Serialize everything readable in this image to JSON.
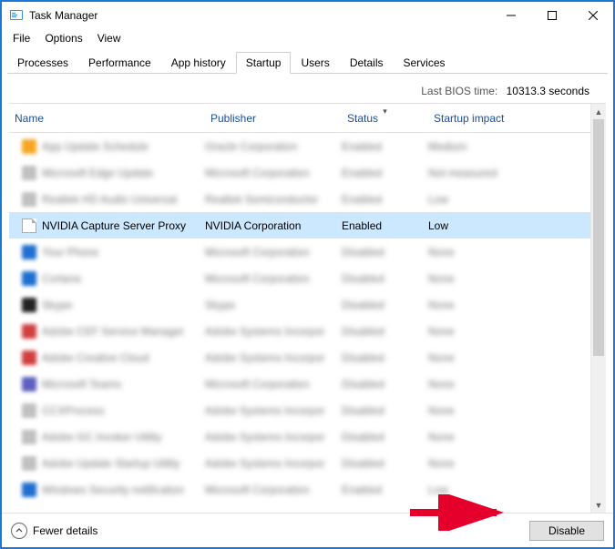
{
  "window": {
    "title": "Task Manager"
  },
  "menu": {
    "file": "File",
    "options": "Options",
    "view": "View"
  },
  "tabs": {
    "processes": "Processes",
    "performance": "Performance",
    "app_history": "App history",
    "startup": "Startup",
    "users": "Users",
    "details": "Details",
    "services": "Services"
  },
  "bios": {
    "label": "Last BIOS time:",
    "value": "10313.3 seconds"
  },
  "columns": {
    "name": "Name",
    "publisher": "Publisher",
    "status": "Status",
    "impact": "Startup impact"
  },
  "selected_row": {
    "name": "NVIDIA Capture Server Proxy",
    "publisher": "NVIDIA Corporation",
    "status": "Enabled",
    "impact": "Low"
  },
  "blurred_rows": [
    {
      "icon_color": "#f5a623",
      "name": "App Update Schedule",
      "publisher": "Oracle Corporation",
      "status": "Enabled",
      "impact": "Medium"
    },
    {
      "icon_color": "#c0c0c0",
      "name": "Microsoft Edge Update",
      "publisher": "Microsoft Corporation",
      "status": "Enabled",
      "impact": "Not measured"
    },
    {
      "icon_color": "#c0c0c0",
      "name": "Realtek HD Audio Universal",
      "publisher": "Realtek Semiconductor",
      "status": "Enabled",
      "impact": "Low"
    }
  ],
  "blurred_rows_after": [
    {
      "icon_color": "#1f6fd0",
      "name": "Your Phone",
      "publisher": "Microsoft Corporation",
      "status": "Disabled",
      "impact": "None"
    },
    {
      "icon_color": "#1f6fd0",
      "name": "Cortana",
      "publisher": "Microsoft Corporation",
      "status": "Disabled",
      "impact": "None"
    },
    {
      "icon_color": "#222222",
      "name": "Skype",
      "publisher": "Skype",
      "status": "Disabled",
      "impact": "None"
    },
    {
      "icon_color": "#d04040",
      "name": "Adobe CEF Service Manager",
      "publisher": "Adobe Systems Incorpor",
      "status": "Disabled",
      "impact": "None"
    },
    {
      "icon_color": "#d04040",
      "name": "Adobe Creative Cloud",
      "publisher": "Adobe Systems Incorpor",
      "status": "Disabled",
      "impact": "None"
    },
    {
      "icon_color": "#6060c0",
      "name": "Microsoft Teams",
      "publisher": "Microsoft Corporation",
      "status": "Disabled",
      "impact": "None"
    },
    {
      "icon_color": "#c0c0c0",
      "name": "CCXProcess",
      "publisher": "Adobe Systems Incorpor",
      "status": "Disabled",
      "impact": "None"
    },
    {
      "icon_color": "#c0c0c0",
      "name": "Adobe GC Invoker Utility",
      "publisher": "Adobe Systems Incorpor",
      "status": "Disabled",
      "impact": "None"
    },
    {
      "icon_color": "#c0c0c0",
      "name": "Adobe Update Startup Utility",
      "publisher": "Adobe Systems Incorpor",
      "status": "Disabled",
      "impact": "None"
    },
    {
      "icon_color": "#1f6fd0",
      "name": "Windows Security notification",
      "publisher": "Microsoft Corporation",
      "status": "Enabled",
      "impact": "Low"
    }
  ],
  "footer": {
    "fewer": "Fewer details",
    "disable": "Disable"
  }
}
